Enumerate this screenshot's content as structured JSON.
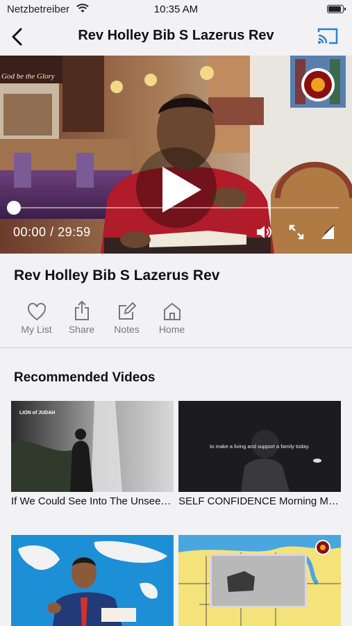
{
  "status": {
    "carrier": "Netzbetreiber",
    "time": "10:35 AM"
  },
  "nav": {
    "title": "Rev Holley Bib S Lazerus Rev"
  },
  "player": {
    "current": "00:00",
    "separator": "/",
    "duration": "29:59",
    "watermark": "God be the Glory",
    "progress": 0.0
  },
  "video": {
    "title": "Rev Holley Bib S Lazerus Rev",
    "actions": [
      {
        "label": "My List",
        "icon": "heart-icon"
      },
      {
        "label": "Share",
        "icon": "share-icon"
      },
      {
        "label": "Notes",
        "icon": "edit-icon"
      },
      {
        "label": "Home",
        "icon": "home-icon"
      }
    ]
  },
  "recommended": {
    "heading": "Recommended Videos",
    "items": [
      {
        "caption": "If We Could See Into The Unseen World",
        "overlay": "LION of JUDAH"
      },
      {
        "caption": "SELF CONFIDENCE  Morning Motivation",
        "overlay": "to make a living and support a family today."
      },
      {
        "caption": "",
        "overlay": ""
      },
      {
        "caption": "",
        "overlay": ""
      }
    ]
  }
}
